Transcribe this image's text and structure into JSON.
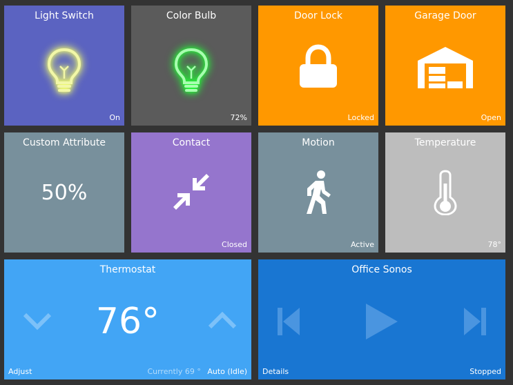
{
  "colors": {
    "background": "#333333",
    "light_switch": "#5b63c1",
    "color_bulb": "#5b5b5b",
    "door_lock": "#ff9800",
    "garage_door": "#ff9800",
    "custom_attribute": "#78909c",
    "contact": "#9575cd",
    "motion": "#78909c",
    "temperature": "#bdbdbd",
    "thermostat": "#42a5f5",
    "office_sonos": "#1976d2",
    "bulb_yellow": "#e6ee6a",
    "bulb_green": "#3cff4c"
  },
  "tiles": {
    "light_switch": {
      "title": "Light Switch",
      "status": "On",
      "icon": "lightbulb-icon"
    },
    "color_bulb": {
      "title": "Color Bulb",
      "status": "72%",
      "icon": "lightbulb-icon"
    },
    "door_lock": {
      "title": "Door Lock",
      "status": "Locked",
      "icon": "lock-icon"
    },
    "garage_door": {
      "title": "Garage Door",
      "status": "Open",
      "icon": "garage-icon"
    },
    "custom_attribute": {
      "title": "Custom Attribute",
      "value": "50%"
    },
    "contact": {
      "title": "Contact",
      "status": "Closed",
      "icon": "compress-arrows-icon"
    },
    "motion": {
      "title": "Motion",
      "status": "Active",
      "icon": "walking-person-icon"
    },
    "temperature": {
      "title": "Temperature",
      "status": "78°",
      "icon": "thermometer-icon"
    },
    "thermostat": {
      "title": "Thermostat",
      "setpoint": "76°",
      "left_label": "Adjust",
      "currently": "Currently 69 °",
      "mode": "Auto (Idle)",
      "down_icon": "chevron-down-icon",
      "up_icon": "chevron-up-icon"
    },
    "office_sonos": {
      "title": "Office Sonos",
      "left_label": "Details",
      "status": "Stopped",
      "prev_icon": "skip-previous-icon",
      "play_icon": "play-icon",
      "next_icon": "skip-next-icon"
    }
  }
}
